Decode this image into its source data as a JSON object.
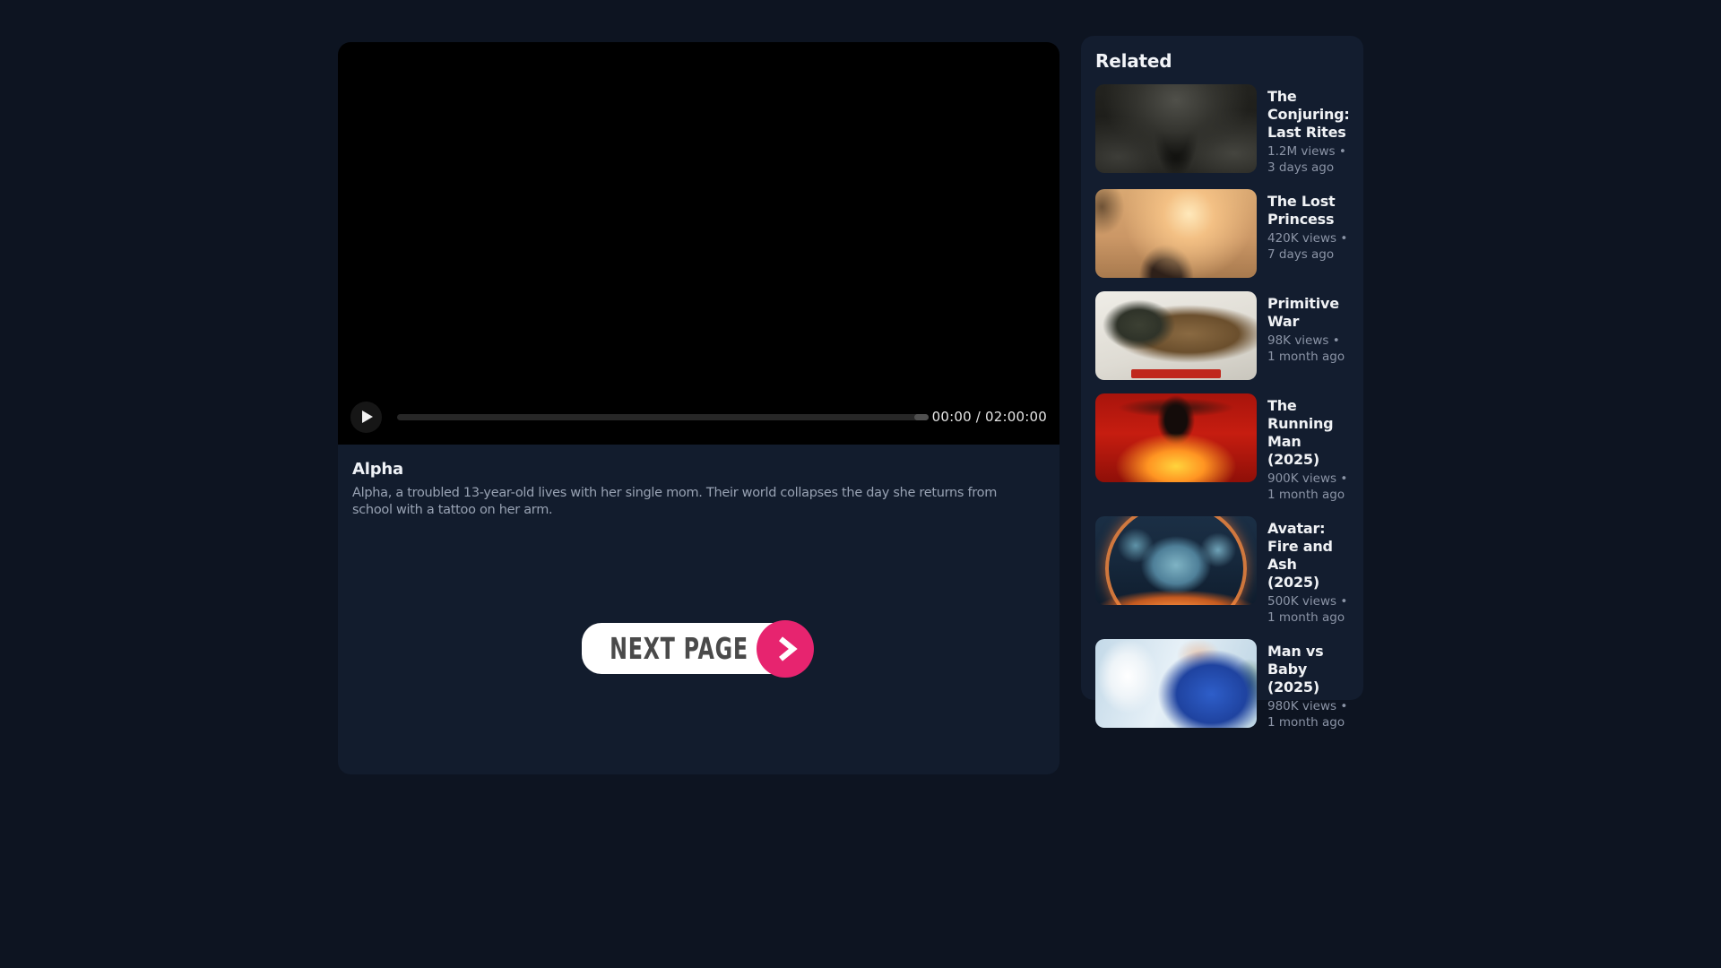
{
  "player": {
    "title": "Alpha",
    "description": "Alpha, a troubled 13-year-old lives with her single mom. Their world collapses the day she returns from school with a tattoo on her arm.",
    "time_display": "00:00 / 02:00:00",
    "current_time": "00:00",
    "duration": "02:00:00",
    "next_page_label": "NEXT PAGE"
  },
  "related": {
    "header": "Related",
    "items": [
      {
        "title": "The Conjuring: Last Rites",
        "meta": "1.2M views • 3 days ago",
        "thumb": "dark-gothic-statues-and-reaching-hands-poster"
      },
      {
        "title": "The Lost Princess",
        "meta": "420K views • 7 days ago",
        "thumb": "desert-sandstorm-couple-poster"
      },
      {
        "title": "Primitive War",
        "meta": "98K views • 1 month ago",
        "thumb": "dinosaur-skull-and-army-helmet-poster"
      },
      {
        "title": "The Running Man (2025)",
        "meta": "900K views • 1 month ago",
        "thumb": "man-in-tuxedo-over-flames-red-poster"
      },
      {
        "title": "Avatar: Fire and Ash (2025)",
        "meta": "500K views • 1 month ago",
        "thumb": "navi-faces-in-fire-ring-poster"
      },
      {
        "title": "Man vs Baby (2025)",
        "meta": "980K views • 1 month ago",
        "thumb": "man-in-blue-jacket-holding-baby-winter-poster"
      }
    ]
  },
  "colors": {
    "page_bg": "#0d1421",
    "card_bg": "#121c2d",
    "sidebar_bg": "#131d2f",
    "accent_pink": "#e7246f"
  }
}
